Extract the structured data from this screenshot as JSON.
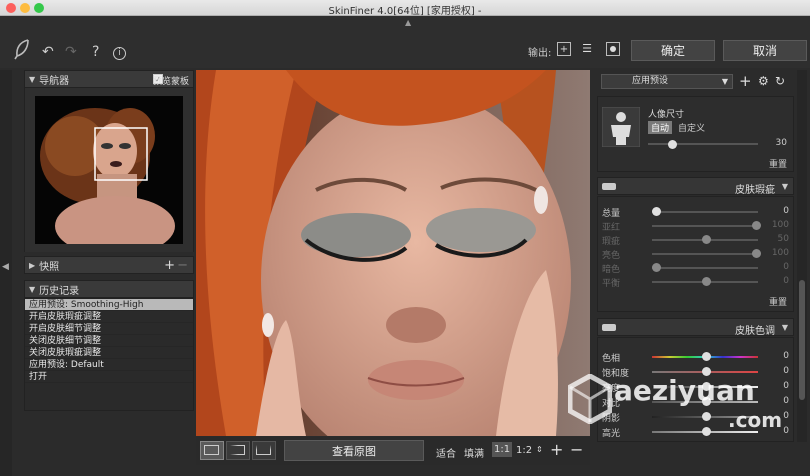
{
  "window": {
    "title": "SkinFiner 4.0[64位] [家用授权] -",
    "traffic_colors": [
      "#fc605c",
      "#fdbc40",
      "#34c84a"
    ]
  },
  "toolbar": {
    "output_label": "输出:",
    "ok_label": "确定",
    "cancel_label": "取消",
    "help_label": "?",
    "info_label": "i"
  },
  "navigator": {
    "title": "导航器",
    "preview_mask_label": "预览蒙板",
    "preview_mask_checked": true
  },
  "snapshots": {
    "title": "快照",
    "add_label": "+",
    "remove_label": "−"
  },
  "history": {
    "title": "历史记录",
    "items": [
      "应用预设: Smoothing-High",
      "开启皮肤瑕疵调整",
      "开启皮肤细节调整",
      "关闭皮肤细节调整",
      "关闭皮肤瑕疵调整",
      "应用预设: Default",
      "打开"
    ]
  },
  "bottombar": {
    "view_original_label": "查看原图",
    "fit_label": "适合",
    "fill_label": "填满",
    "zoom_1_1": "1:1",
    "zoom_1_2": "1:2",
    "plus": "+",
    "minus": "−"
  },
  "right_panel": {
    "preset_label": "应用预设",
    "portrait": {
      "title": "人像尺寸",
      "auto_label": "自动",
      "custom_label": "自定义",
      "value": "30",
      "slider_fraction": 0.2,
      "reset_label": "重置"
    },
    "blemish": {
      "title": "皮肤瑕疵",
      "reset_label": "重置",
      "sliders": [
        {
          "label": "总量",
          "value": "0",
          "fraction": 0.0,
          "dim": false
        },
        {
          "label": "亚红",
          "value": "100",
          "fraction": 1.0,
          "dim": true
        },
        {
          "label": "瑕疵",
          "value": "50",
          "fraction": 0.5,
          "dim": true
        },
        {
          "label": "亮色",
          "value": "100",
          "fraction": 1.0,
          "dim": true
        },
        {
          "label": "暗色",
          "value": "0",
          "fraction": 0.0,
          "dim": true
        },
        {
          "label": "平衡",
          "value": "0",
          "fraction": 0.5,
          "dim": true
        }
      ]
    },
    "skin_tone": {
      "title": "皮肤色调",
      "sliders": [
        {
          "label": "色相",
          "value": "0",
          "fraction": 0.5,
          "dim": false
        },
        {
          "label": "饱和度",
          "value": "0",
          "fraction": 0.5,
          "dim": false
        },
        {
          "label": "亮度",
          "value": "0",
          "fraction": 0.5,
          "dim": false
        },
        {
          "label": "对比",
          "value": "0",
          "fraction": 0.5,
          "dim": false
        },
        {
          "label": "阴影",
          "value": "0",
          "fraction": 0.5,
          "dim": false
        },
        {
          "label": "高光",
          "value": "0",
          "fraction": 0.5,
          "dim": false
        }
      ]
    }
  },
  "watermark": {
    "text": "aeziyuan",
    "domain": ".com"
  }
}
